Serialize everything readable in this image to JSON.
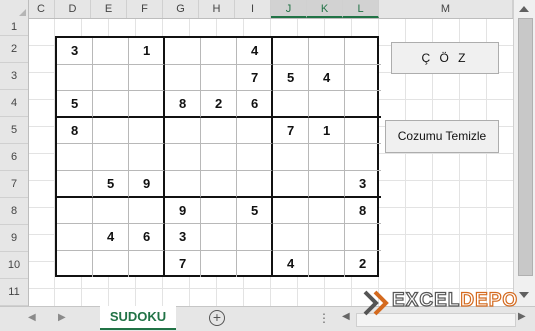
{
  "columns": [
    {
      "label": "C",
      "selected": false
    },
    {
      "label": "D",
      "selected": false
    },
    {
      "label": "E",
      "selected": false
    },
    {
      "label": "F",
      "selected": false
    },
    {
      "label": "G",
      "selected": false
    },
    {
      "label": "H",
      "selected": false
    },
    {
      "label": "I",
      "selected": false
    },
    {
      "label": "J",
      "selected": true
    },
    {
      "label": "K",
      "selected": true
    },
    {
      "label": "L",
      "selected": true
    },
    {
      "label": "M",
      "selected": false
    }
  ],
  "rows": [
    "1",
    "2",
    "3",
    "4",
    "5",
    "6",
    "7",
    "8",
    "9",
    "10",
    "11"
  ],
  "sudoku": {
    "grid": [
      [
        "3",
        "",
        "1",
        "",
        "",
        "4",
        "",
        "",
        ""
      ],
      [
        "",
        "",
        "",
        "",
        "",
        "7",
        "5",
        "4",
        ""
      ],
      [
        "5",
        "",
        "",
        "8",
        "2",
        "6",
        "",
        "",
        ""
      ],
      [
        "8",
        "",
        "",
        "",
        "",
        "",
        "7",
        "1",
        ""
      ],
      [
        "",
        "",
        "",
        "",
        "",
        "",
        "",
        "",
        ""
      ],
      [
        "",
        "5",
        "9",
        "",
        "",
        "",
        "",
        "",
        "3"
      ],
      [
        "",
        "",
        "",
        "9",
        "",
        "5",
        "",
        "",
        "8"
      ],
      [
        "",
        "4",
        "6",
        "3",
        "",
        "",
        "",
        "",
        ""
      ],
      [
        "",
        "",
        "",
        "7",
        "",
        "",
        "4",
        "",
        "2"
      ]
    ]
  },
  "buttons": {
    "solve_label": "Ç Ö Z",
    "clear_label": "Cozumu Temizle"
  },
  "tabs": {
    "active_sheet": "SUDOKU",
    "add_symbol": "+"
  },
  "logo": {
    "text_excel": "EXCEL",
    "text_depo": "DEPO"
  },
  "colors": {
    "excel_green": "#217346",
    "logo_orange": "#d46a1f"
  }
}
